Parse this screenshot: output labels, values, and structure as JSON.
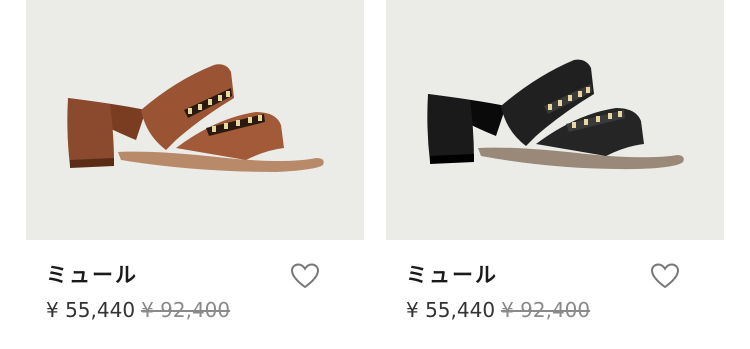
{
  "products": [
    {
      "name": "ミュール",
      "price": "¥ 55,440",
      "original_price": "¥ 92,400",
      "image_alt": "brown leather heeled mule with chain detail",
      "color": "#8b4a2e",
      "wishlist_icon": "heart-outline-icon"
    },
    {
      "name": "ミュール",
      "price": "¥ 55,440",
      "original_price": "¥ 92,400",
      "image_alt": "black leather heeled mule with chain detail",
      "color": "#141414",
      "wishlist_icon": "heart-outline-icon"
    }
  ],
  "colors": {
    "image_bg": "#ebebe8",
    "text": "#1a1a1a",
    "strike": "#8a8a8a"
  }
}
